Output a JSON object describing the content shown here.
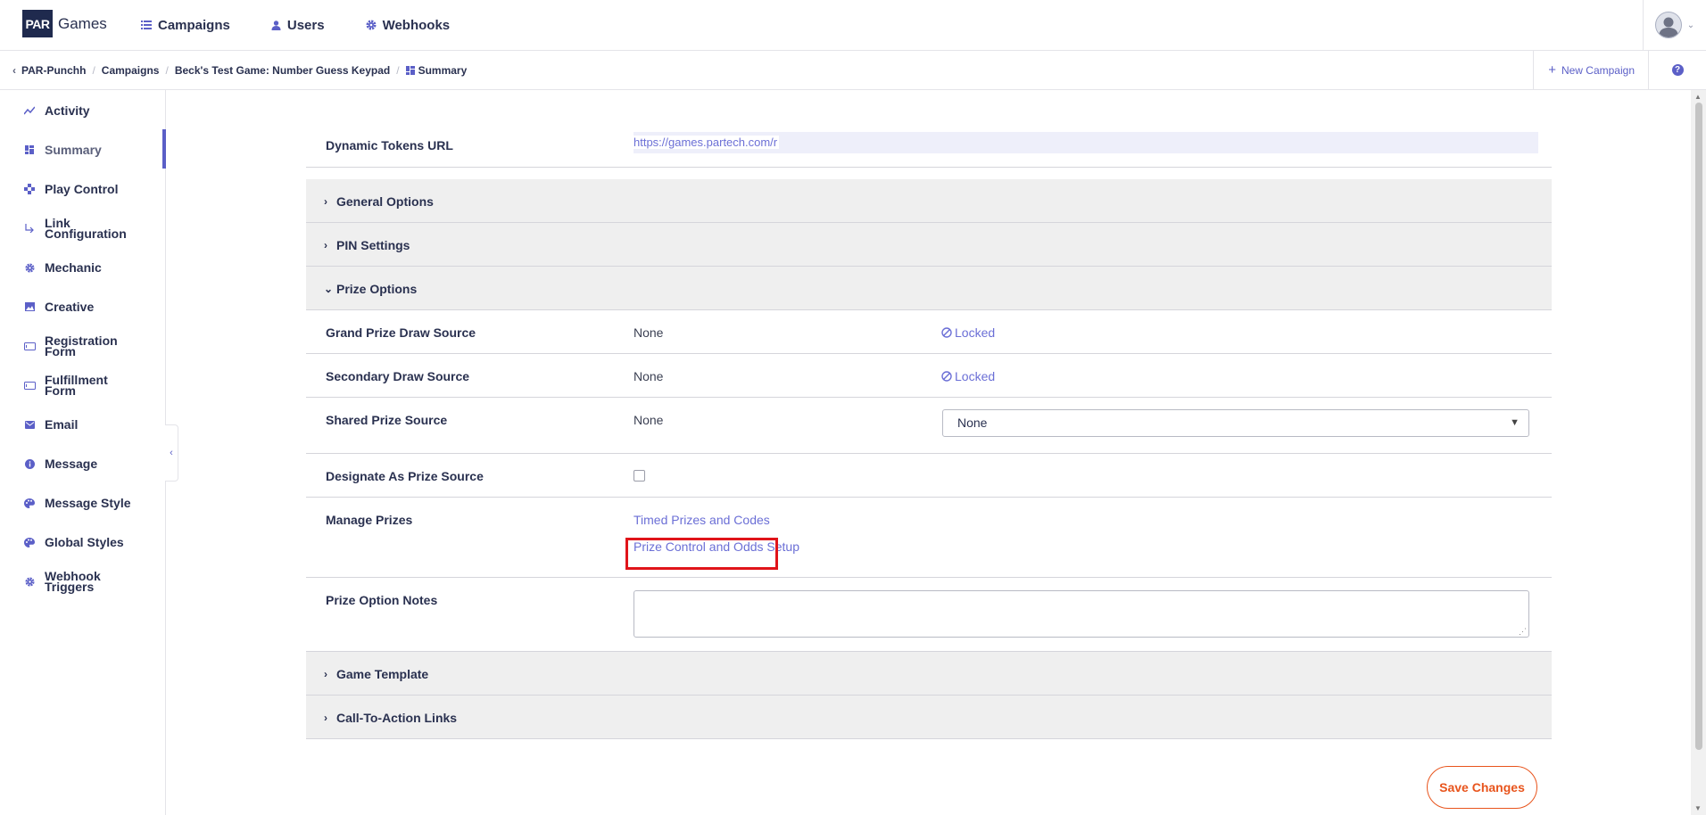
{
  "brand": {
    "logo_mark": "PAR",
    "logo_text": "Games"
  },
  "topnav": {
    "campaigns": "Campaigns",
    "users": "Users",
    "webhooks": "Webhooks"
  },
  "breadcrumb": {
    "root": "PAR-Punchh",
    "campaigns": "Campaigns",
    "game": "Beck's Test Game: Number Guess Keypad",
    "current": "Summary"
  },
  "actions": {
    "new_campaign": "New Campaign",
    "help": "?"
  },
  "sidebar": {
    "items": [
      {
        "label": "Activity",
        "icon": "activity-icon"
      },
      {
        "label": "Summary",
        "icon": "summary-icon",
        "active": true
      },
      {
        "label": "Play Control",
        "icon": "play-control-icon"
      },
      {
        "label": "Link Configuration",
        "icon": "link-icon"
      },
      {
        "label": "Mechanic",
        "icon": "gear-icon"
      },
      {
        "label": "Creative",
        "icon": "image-icon"
      },
      {
        "label": "Registration Form",
        "icon": "form-icon"
      },
      {
        "label": "Fulfillment Form",
        "icon": "form-icon"
      },
      {
        "label": "Email",
        "icon": "email-icon"
      },
      {
        "label": "Message",
        "icon": "info-icon"
      },
      {
        "label": "Message Style",
        "icon": "palette-icon"
      },
      {
        "label": "Global Styles",
        "icon": "palette-icon"
      },
      {
        "label": "Webhook Triggers",
        "icon": "gear-icon"
      }
    ],
    "collapse": "‹"
  },
  "main": {
    "dynamic_tokens": {
      "label": "Dynamic Tokens URL",
      "value": "https://games.partech.com/r"
    },
    "sections": {
      "general": "General Options",
      "pin": "PIN Settings",
      "prize": "Prize Options",
      "template": "Game Template",
      "cta": "Call-To-Action Links"
    },
    "prize_rows": {
      "grand": {
        "label": "Grand Prize Draw Source",
        "value": "None",
        "status": "Locked"
      },
      "secondary": {
        "label": "Secondary Draw Source",
        "value": "None",
        "status": "Locked"
      },
      "shared": {
        "label": "Shared Prize Source",
        "value": "None",
        "select_value": "None"
      },
      "designate": {
        "label": "Designate As Prize Source",
        "checked": false
      },
      "manage": {
        "label": "Manage Prizes",
        "link1": "Timed Prizes and Codes",
        "link2": "Prize Control and Odds Setup"
      },
      "notes": {
        "label": "Prize Option Notes",
        "value": ""
      }
    },
    "save_label": "Save Changes"
  },
  "colors": {
    "accent": "#5b5fc7",
    "save": "#e8541c",
    "highlight": "#e0141a",
    "navy": "#1f2a4e"
  }
}
